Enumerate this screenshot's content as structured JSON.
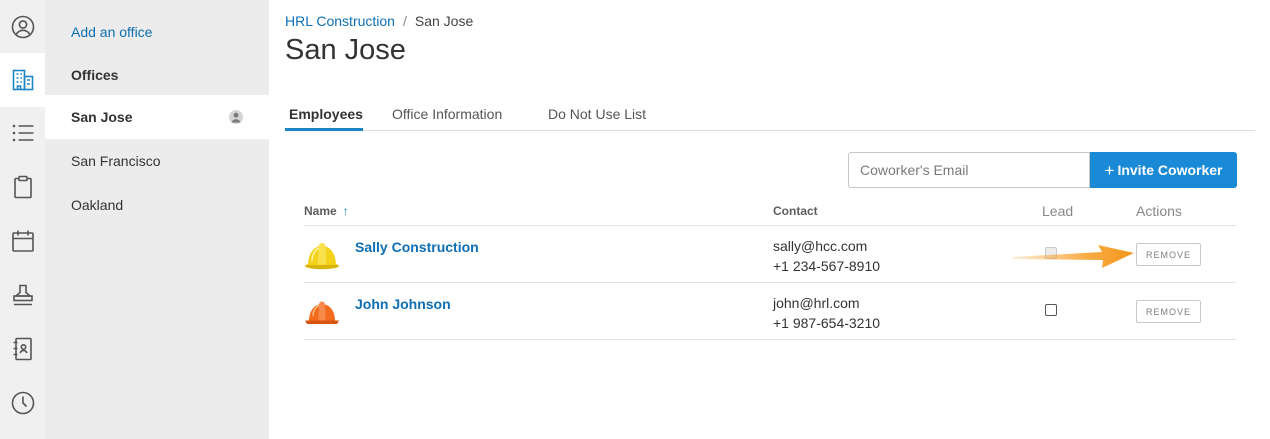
{
  "rail": {
    "icons": [
      "user-circle-icon",
      "building-icon",
      "list-icon",
      "clipboard-icon",
      "calendar-icon",
      "stamp-icon",
      "address-book-icon",
      "clock-icon"
    ],
    "active": "building-icon"
  },
  "sidebar": {
    "add_label": "Add an office",
    "heading": "Offices",
    "items": [
      {
        "label": "San Jose",
        "active": true
      },
      {
        "label": "San Francisco"
      },
      {
        "label": "Oakland"
      }
    ]
  },
  "breadcrumb": {
    "parent": "HRL Construction",
    "separator": "/",
    "current": "San Jose"
  },
  "page": {
    "title": "San Jose"
  },
  "tabs": [
    {
      "label": "Employees",
      "active": true
    },
    {
      "label": "Office Information"
    },
    {
      "label": "Do Not Use List"
    }
  ],
  "invite": {
    "placeholder": "Coworker's Email",
    "plus": "+",
    "button_label": "Invite Coworker"
  },
  "table": {
    "headers": {
      "name": "Name",
      "sort_indicator": "↑",
      "contact": "Contact",
      "lead": "Lead",
      "actions": "Actions"
    },
    "rows": [
      {
        "name": "Sally Construction",
        "email": "sally@hcc.com",
        "phone": "+1 234-567-8910",
        "lead": false,
        "lead_disabled": true,
        "action": "REMOVE",
        "avatar": "yellow-hardhat-icon"
      },
      {
        "name": "John Johnson",
        "email": "john@hrl.com",
        "phone": "+1 987-654-3210",
        "lead": false,
        "lead_disabled": false,
        "action": "REMOVE",
        "avatar": "orange-hardhat-icon"
      }
    ]
  },
  "colors": {
    "accent": "#1b8ad6",
    "link": "#0e6fb4",
    "annotation_arrow": "#f7a331",
    "yellow_hardhat": "#f4d21c",
    "orange_hardhat": "#f36b1c"
  }
}
